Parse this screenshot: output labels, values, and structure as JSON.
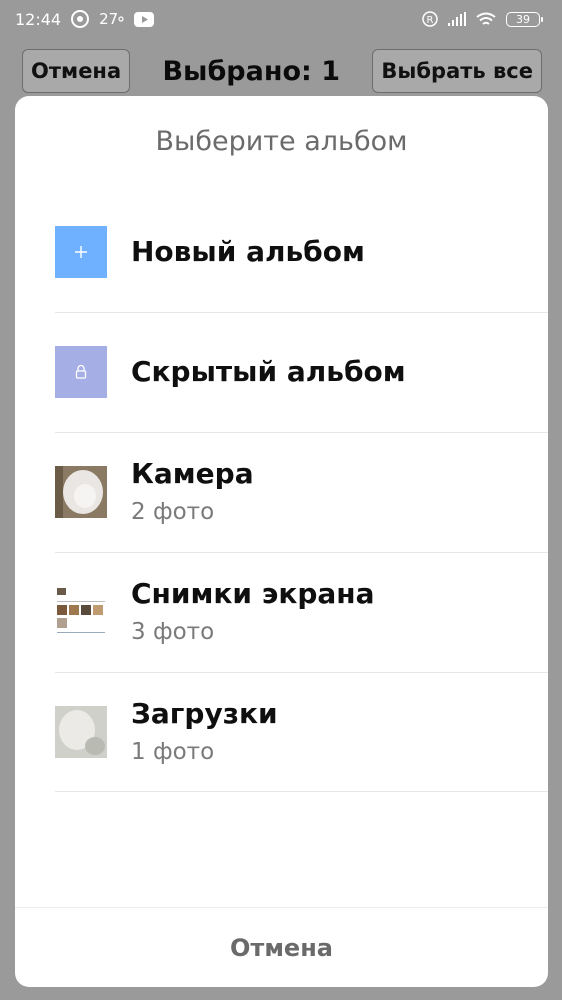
{
  "status_bar": {
    "time": "12:44",
    "temperature": "27",
    "battery": "39",
    "icons": [
      "chrome-icon",
      "youtube-icon",
      "roaming-r-icon",
      "signal-icon",
      "wifi-icon",
      "battery-icon"
    ]
  },
  "toolbar": {
    "cancel_label": "Отмена",
    "title": "Выбрано: 1",
    "select_all_label": "Выбрать все"
  },
  "dialog": {
    "title": "Выберите альбом",
    "albums": [
      {
        "name": "Новый альбом",
        "count": "",
        "icon": "plus-icon",
        "color": "#6fb1ff"
      },
      {
        "name": "Скрытый альбом",
        "count": "",
        "icon": "lock-icon",
        "color": "#a6aee6"
      },
      {
        "name": "Камера",
        "count": "2 фото",
        "icon": "camera-album-thumbnail"
      },
      {
        "name": "Снимки экрана",
        "count": "3 фото",
        "icon": "screenshots-album-thumbnail"
      },
      {
        "name": "Загрузки",
        "count": "1 фото",
        "icon": "downloads-album-thumbnail"
      }
    ],
    "cancel_label": "Отмена"
  }
}
